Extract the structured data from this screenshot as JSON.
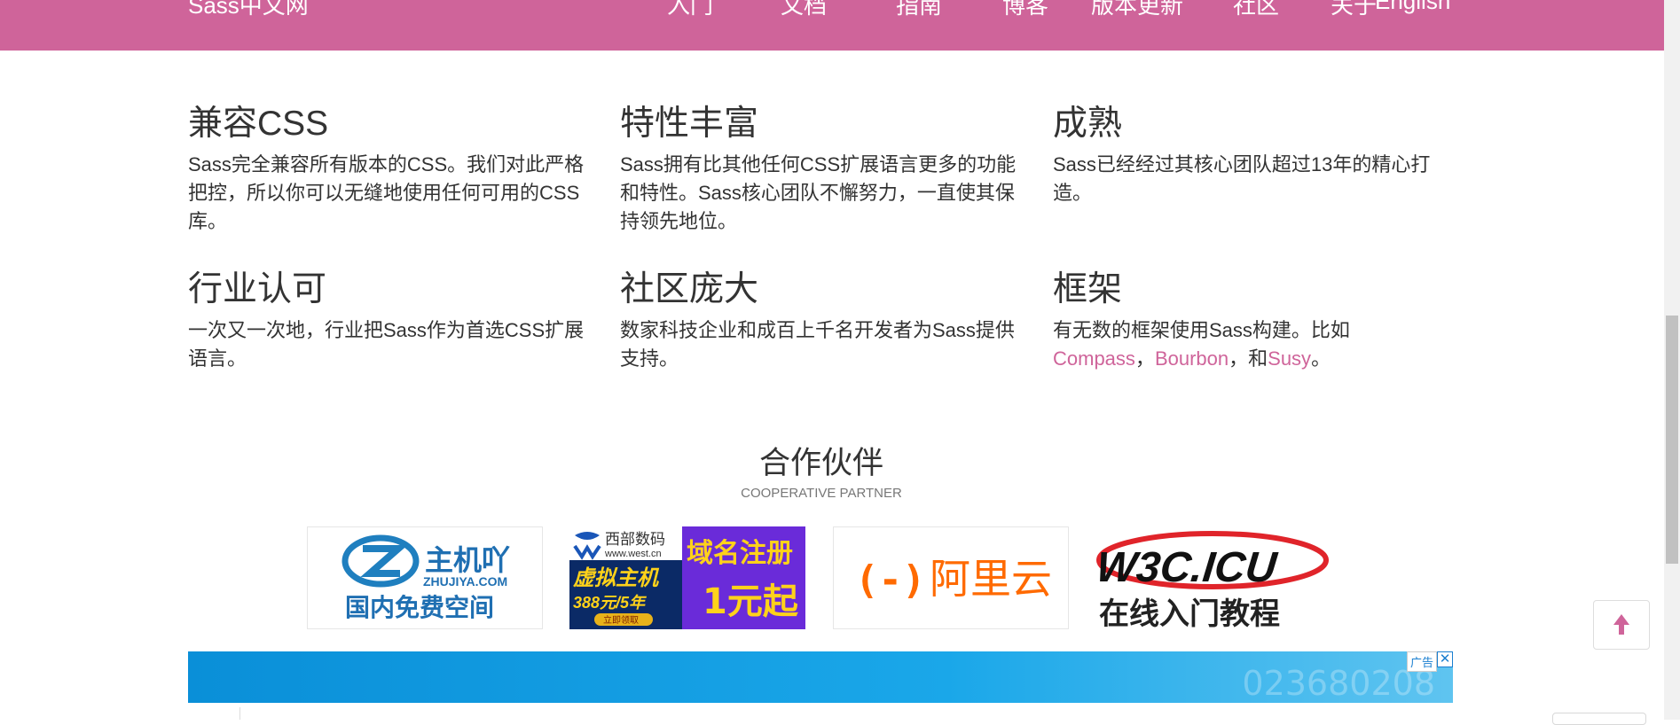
{
  "header": {
    "brand": "Sass中文网",
    "nav": [
      "入门",
      "文档",
      "指南",
      "博客",
      "版本更新",
      "社区",
      "关于",
      "English"
    ]
  },
  "features": [
    {
      "title": "兼容CSS",
      "desc": "Sass完全兼容所有版本的CSS。我们对此严格把控，所以你可以无缝地使用任何可用的CSS库。"
    },
    {
      "title": "特性丰富",
      "desc": "Sass拥有比其他任何CSS扩展语言更多的功能和特性。Sass核心团队不懈努力，一直使其保持领先地位。"
    },
    {
      "title": "成熟",
      "desc": "Sass已经经过其核心团队超过13年的精心打造。"
    },
    {
      "title": "行业认可",
      "desc": "一次又一次地，行业把Sass作为首选CSS扩展语言。"
    },
    {
      "title": "社区庞大",
      "desc": "数家科技企业和成百上千名开发者为Sass提供支持。"
    },
    {
      "title": "框架",
      "desc_prefix": "有无数的框架使用Sass构建。比如",
      "links": [
        "Compass",
        "Bourbon",
        "Susy"
      ],
      "sep1": "，",
      "sep2": "，和",
      "end": "。"
    }
  ],
  "partners": {
    "title": "合作伙伴",
    "subtitle": "COOPERATIVE PARTNER",
    "logos": [
      {
        "name": "主机吖",
        "sub": "ZHUJIYA.COM",
        "slogan": "国内免费空间"
      },
      {
        "name": "西部数码",
        "sub": "www.west.cn",
        "line1": "虚拟主机",
        "line2": "388元/5年",
        "cta": "立即领取",
        "right1": "域名注册",
        "right2": "1元起"
      },
      {
        "name": "阿里云",
        "mark": "(-)"
      },
      {
        "name": "W3C.ICU",
        "slogan": "在线入门教程"
      }
    ]
  },
  "ad": {
    "label": "广告",
    "close": "✕",
    "ghost_text": "023680208"
  },
  "colors": {
    "brand": "#cf649a",
    "text": "#333333",
    "muted": "#777777"
  }
}
